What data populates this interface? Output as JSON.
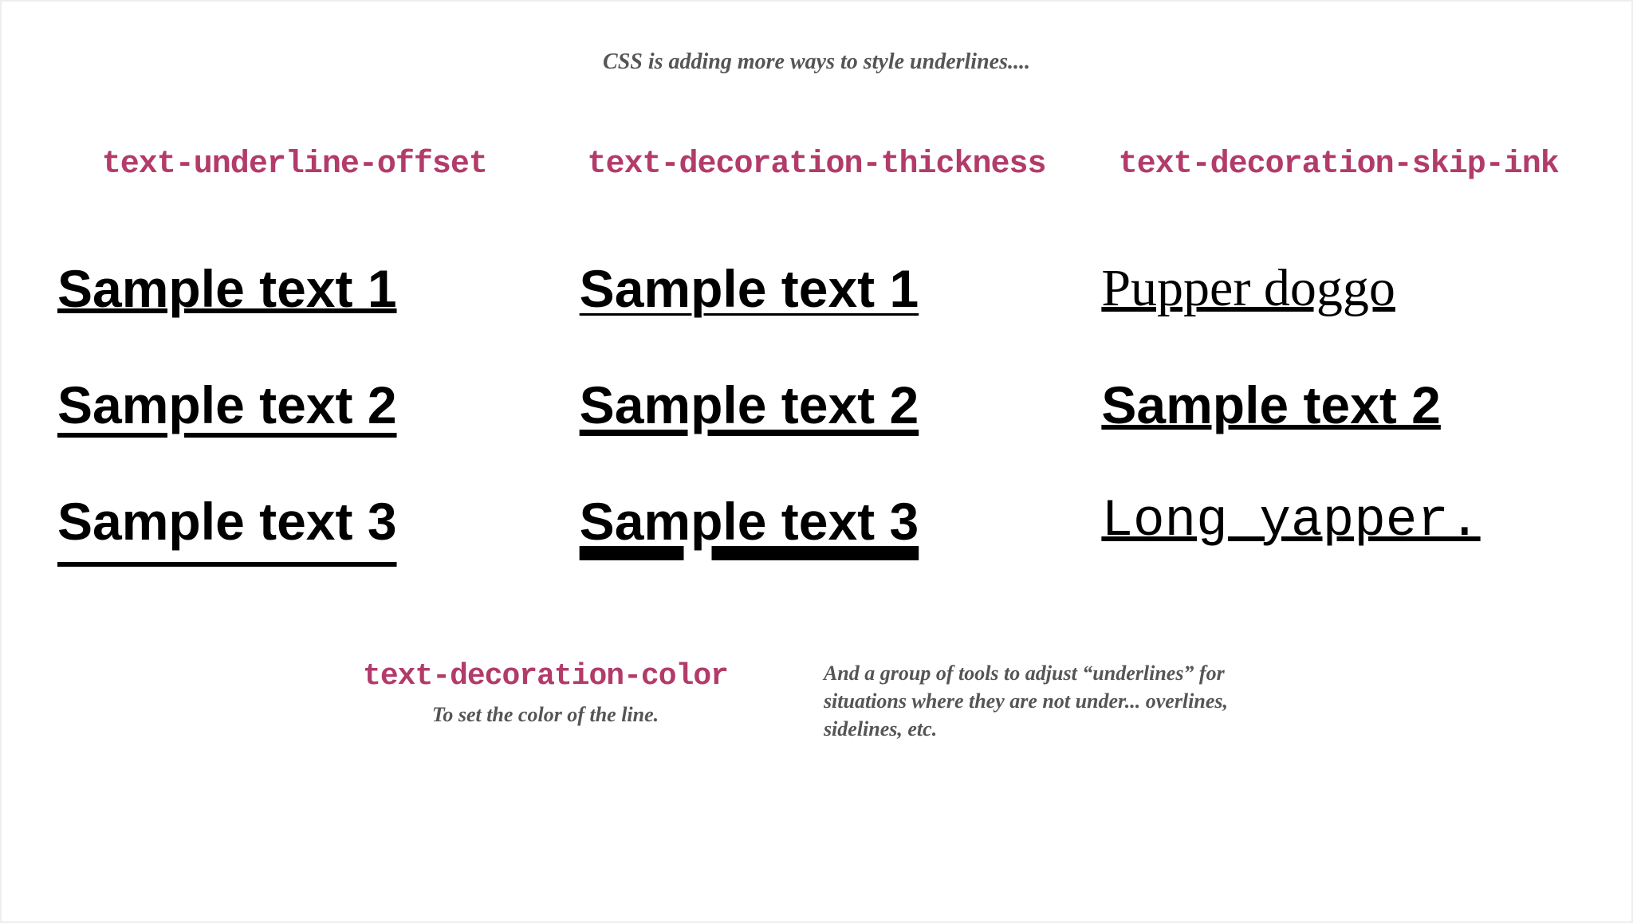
{
  "intro": "CSS is adding more ways to style underlines....",
  "columns": [
    {
      "heading": "text-underline-offset",
      "samples": [
        "Sample text 1",
        "Sample text 2",
        "Sample text 3"
      ]
    },
    {
      "heading": "text-decoration-thickness",
      "samples": [
        "Sample text 1",
        "Sample text 2",
        "Sample text 3"
      ]
    },
    {
      "heading": "text-decoration-skip-ink",
      "samples": [
        "Pupper doggo",
        "Sample text 2",
        "Long yapper."
      ]
    }
  ],
  "footer": {
    "left_heading": "text-decoration-color",
    "left_sub": "To set the color of the line.",
    "right_text": "And a group of tools to adjust “underlines” for situations where they are not under... overlines, sidelines, etc."
  }
}
